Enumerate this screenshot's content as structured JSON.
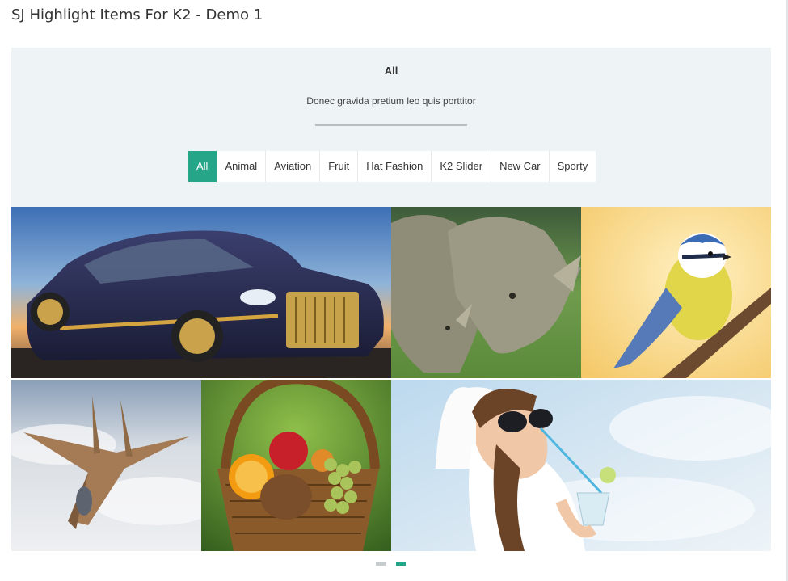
{
  "page": {
    "title": "SJ Highlight Items For K2 - Demo 1"
  },
  "module": {
    "heading": "All",
    "description": "Donec gravida pretium leo quis porttitor",
    "active_tab": "All",
    "tabs": [
      {
        "label": "All"
      },
      {
        "label": "Animal"
      },
      {
        "label": "Aviation"
      },
      {
        "label": "Fruit"
      },
      {
        "label": "Hat Fashion"
      },
      {
        "label": "K2 Slider"
      },
      {
        "label": "New Car"
      },
      {
        "label": "Sporty"
      }
    ]
  },
  "items": [
    {
      "subject": "luxury-car"
    },
    {
      "subject": "rhinoceros"
    },
    {
      "subject": "blue-tit-bird"
    },
    {
      "subject": "fighter-jet"
    },
    {
      "subject": "fruit-basket"
    },
    {
      "subject": "woman-with-sunglasses"
    }
  ],
  "pager": {
    "pages": 2,
    "current": 2
  },
  "colors": {
    "accent": "#26a589",
    "panel": "#eef3f5"
  }
}
